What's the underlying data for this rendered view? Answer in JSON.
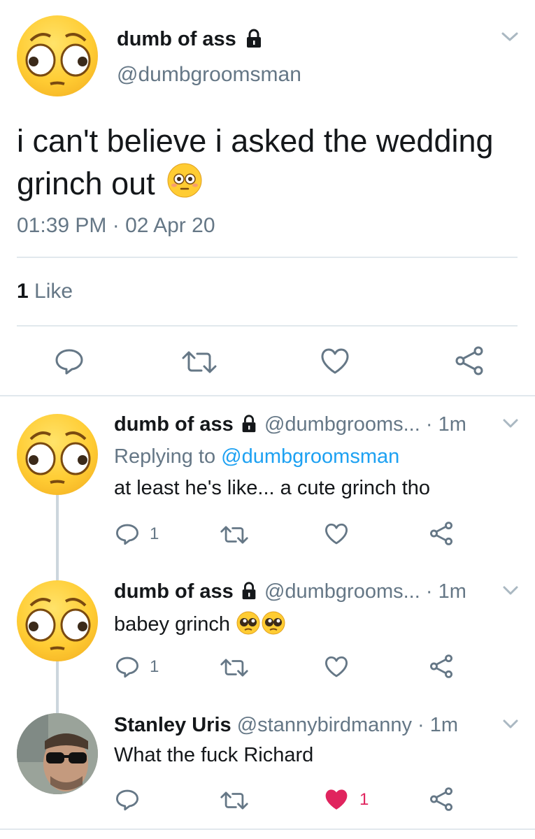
{
  "main_tweet": {
    "display_name": "dumb of ass",
    "handle": "@dumbgroomsman",
    "text": "i can't believe i asked the wedding",
    "text_line2": "grinch out",
    "timestamp": "01:39 PM · 02 Apr 20",
    "like_count": "1",
    "like_label": "Like"
  },
  "replies": [
    {
      "display_name": "dumb of ass",
      "handle": "@dumbgrooms...",
      "time": "· 1m",
      "replying_prefix": "Replying to",
      "replying_to": "@dumbgroomsman",
      "text": "at least he's like... a cute grinch tho",
      "reply_count": "1"
    },
    {
      "display_name": "dumb of ass",
      "handle": "@dumbgrooms...",
      "time": "· 1m",
      "text": "babey grinch",
      "reply_count": "1"
    },
    {
      "display_name": "Stanley Uris",
      "handle": "@stannybirdmanny",
      "time": "· 1m",
      "text": "What the fuck Richard",
      "like_count": "1"
    }
  ],
  "icons": {
    "reply": "speech-bubble-icon",
    "retweet": "retweet-icon",
    "like": "heart-icon",
    "share": "share-icon",
    "lock": "lock-icon",
    "caret": "chevron-down-icon"
  },
  "colors": {
    "text": "#14171a",
    "muted": "#657786",
    "link": "#1da1f2",
    "like_active": "#e0245e",
    "divider": "#e1e8ed"
  }
}
